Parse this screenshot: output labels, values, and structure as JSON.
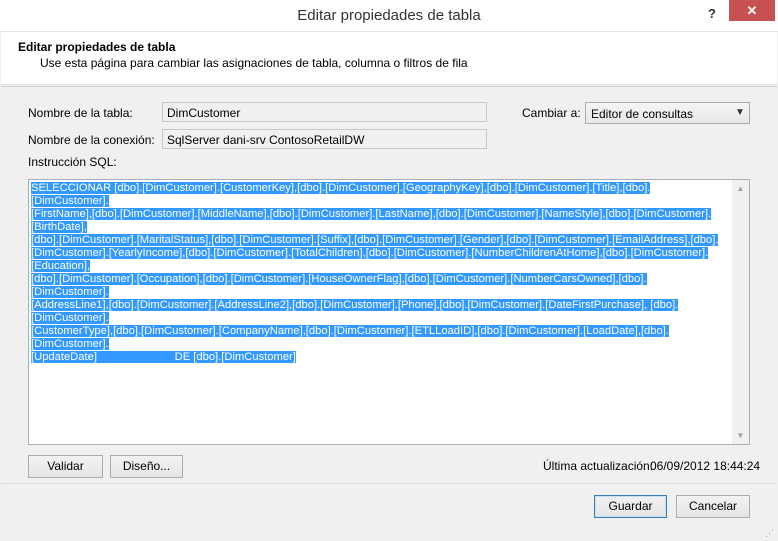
{
  "window": {
    "title": "Editar propiedades de tabla",
    "help": "?",
    "close": "✕"
  },
  "header": {
    "title": "Editar propiedades de tabla",
    "subtitle": "Use esta página para cambiar las asignaciones de tabla, columna o filtros de fila"
  },
  "form": {
    "table_name_label": "Nombre de la tabla:",
    "table_name_value": "DimCustomer",
    "connection_label": "Nombre de la conexión:",
    "connection_value": "SqlServer dani-srv ContosoRetailDW",
    "change_label": "Cambiar a:",
    "change_value": "Editor de consultas",
    "sql_label": "Instrucción SQL:"
  },
  "sql": {
    "lines": [
      "SELECCIONAR [dbo].[DimCustomer].[CustomerKey],[dbo].[DimCustomer].[GeographyKey],[dbo].[DimCustomer].[Title],[dbo].[DimCustomer].",
      "[FirstName],[dbo].[DimCustomer].[MiddleName],[dbo].[DimCustomer].[LastName],[dbo].[DimCustomer].[NameStyle],[dbo].[DimCustomer].[BirthDate],",
      "[dbo].[DimCustomer].[MaritalStatus],[dbo].[DimCustomer].[Suffix],[dbo].[DimCustomer].[Gender],[dbo].[DimCustomer].[EmailAddress],[dbo].",
      "[DimCustomer].[YearlyIncome],[dbo].[DimCustomer].[TotalChildren],[dbo].[DimCustomer].[NumberChildrenAtHome],[dbo].[DimCustomer].[Education],",
      "[dbo].[DimCustomer].[Occupation],[dbo].[DimCustomer].[HouseOwnerFlag],[dbo].[DimCustomer].[NumberCarsOwned],[dbo].[DimCustomer].",
      "[AddressLine1],[dbo].[DimCustomer].[AddressLine2],[dbo].[DimCustomer].[Phone],[dbo].[DimCustomer].[DateFirstPurchase], [dbo].[DimCustomer].",
      "[CustomerType],[dbo].[DimCustomer].[CompanyName],[dbo].[DimCustomer].[ETLLoadID],[dbo].[DimCustomer].[LoadDate],[dbo].[DimCustomer].",
      "[UpdateDate]                         DE [dbo].[DimCustomer]"
    ]
  },
  "buttons": {
    "validate": "Validar",
    "design": "Diseño...",
    "save": "Guardar",
    "cancel": "Cancelar"
  },
  "status": {
    "updated_label": "Última actualización:",
    "updated_value": "06/09/2012 18:44:24"
  }
}
